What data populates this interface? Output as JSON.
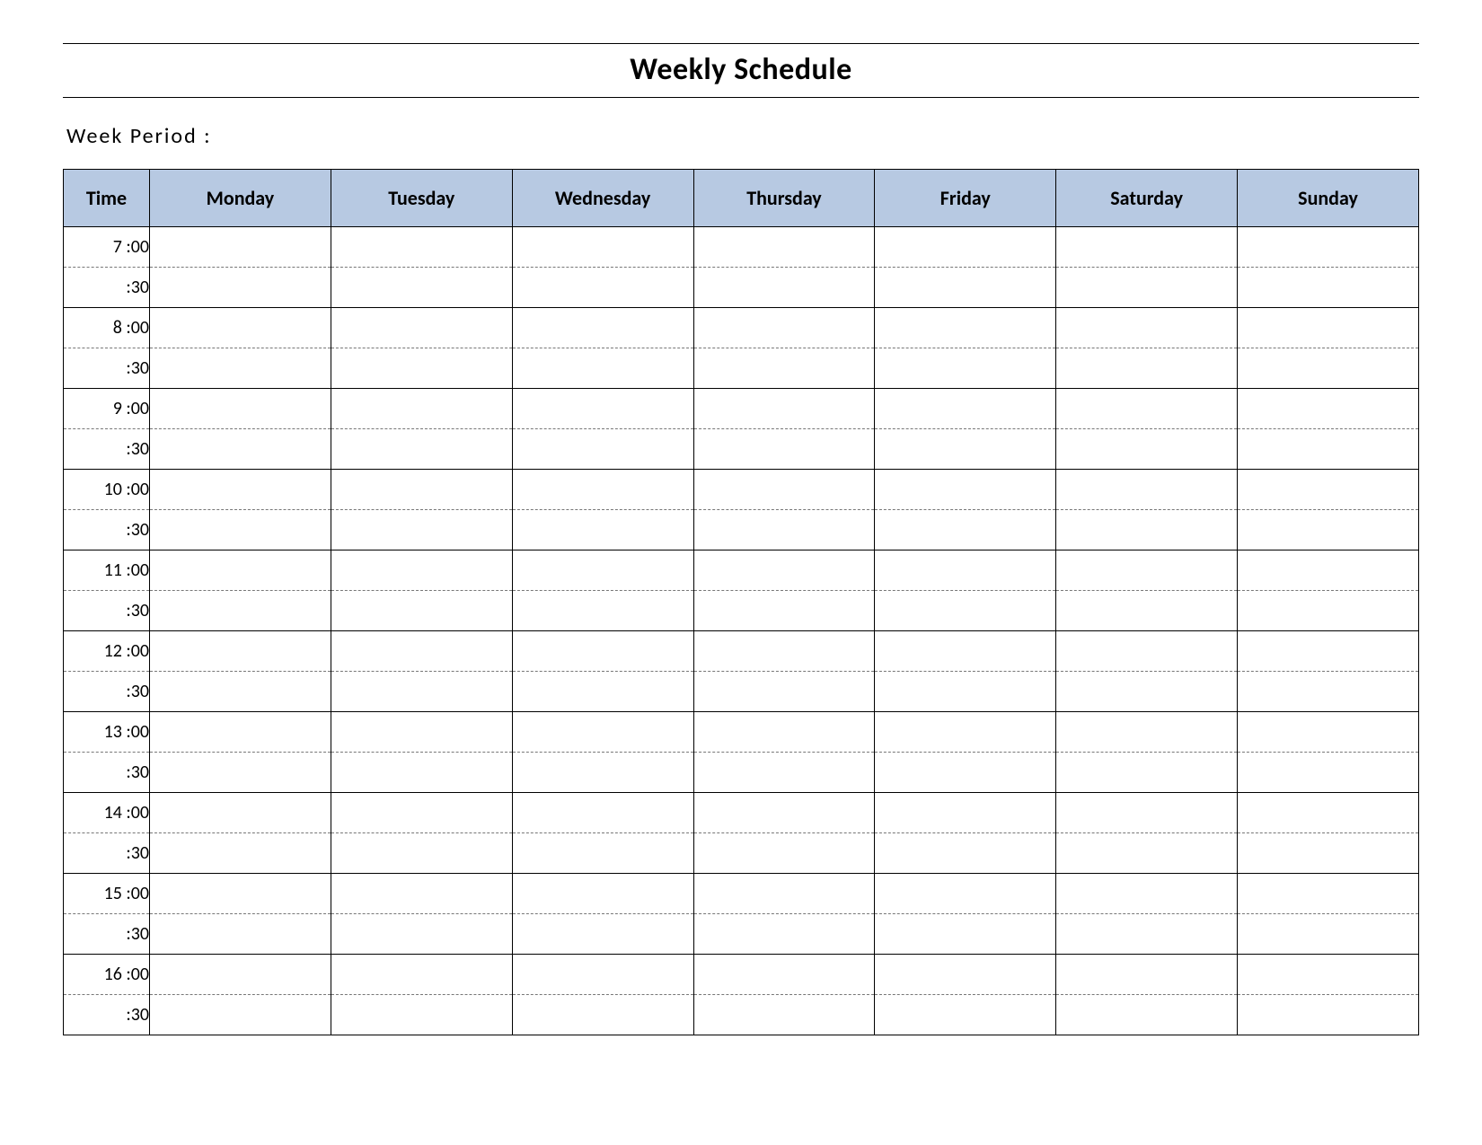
{
  "title": "Weekly Schedule",
  "week_period_label": "Week  Period :",
  "headers": {
    "time": "Time",
    "days": [
      "Monday",
      "Tuesday",
      "Wednesday",
      "Thursday",
      "Friday",
      "Saturday",
      "Sunday"
    ]
  },
  "time_rows": [
    "7  :00",
    ":30",
    "8  :00",
    ":30",
    "9  :00",
    ":30",
    "10  :00",
    ":30",
    "11  :00",
    ":30",
    "12  :00",
    ":30",
    "13  :00",
    ":30",
    "14  :00",
    ":30",
    "15  :00",
    ":30",
    "16  :00",
    ":30"
  ],
  "colors": {
    "header_bg": "#b7c9e2"
  }
}
